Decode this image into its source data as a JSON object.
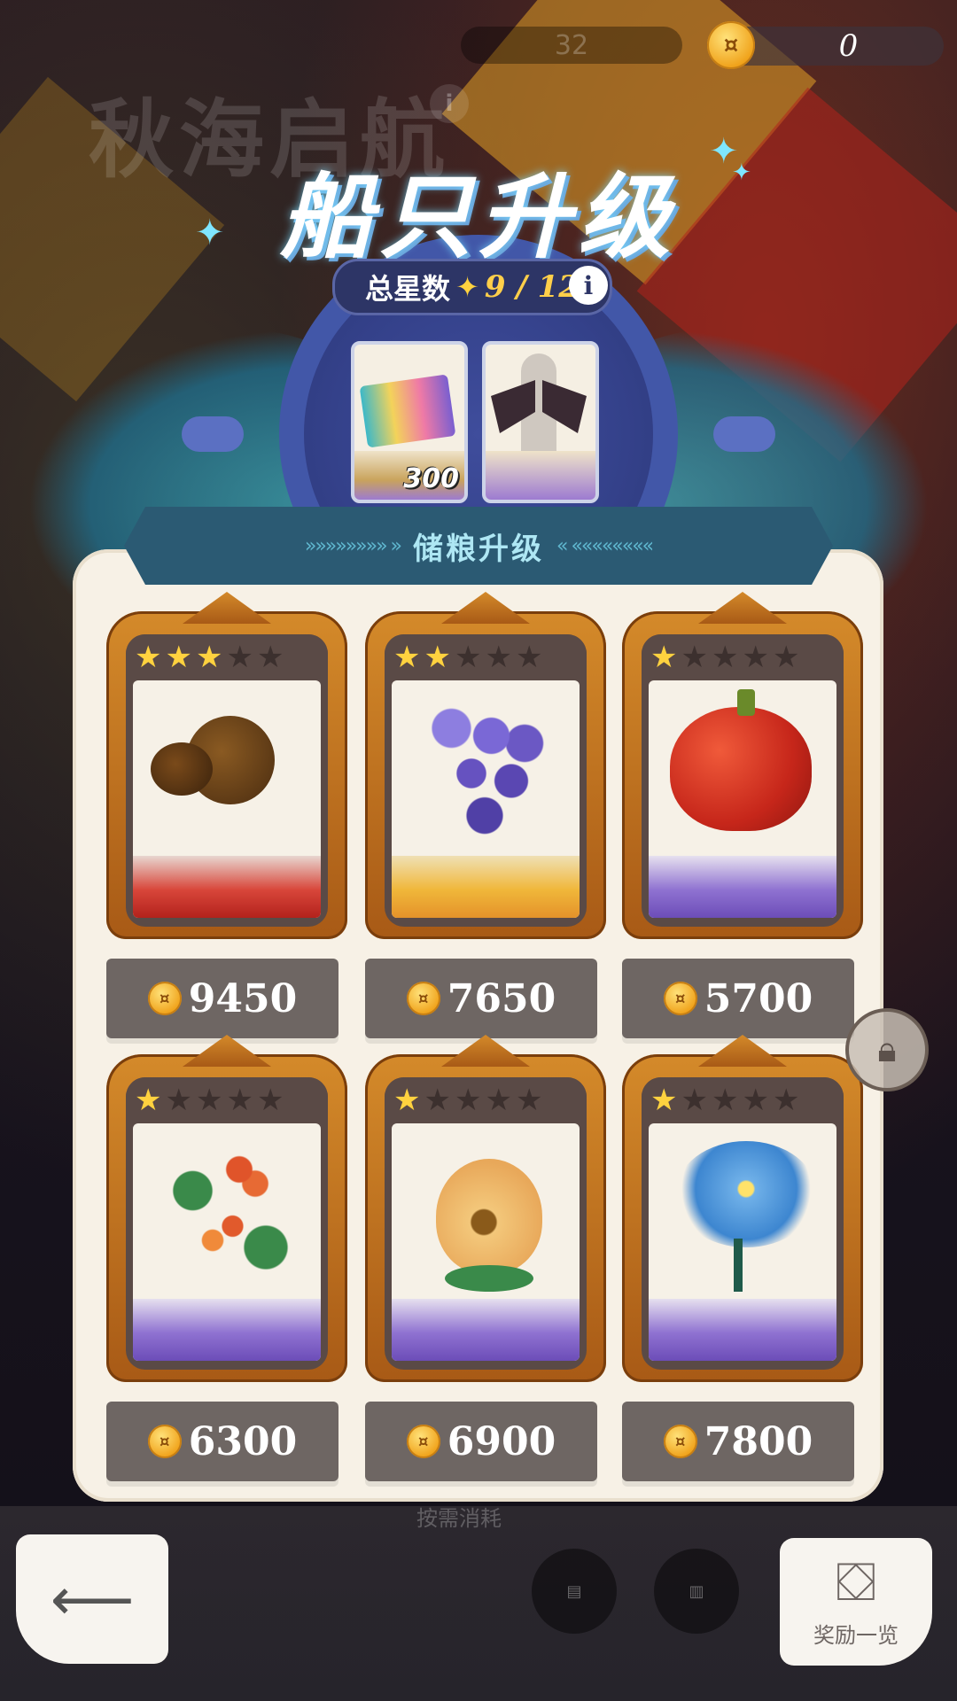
{
  "header": {
    "bg_title": "秋海启航",
    "bg_counter": "32",
    "currency_value": "0"
  },
  "upgrade": {
    "title": "船只升级",
    "stars_label": "总星数",
    "stars_count": "9 / 12",
    "info_symbol": "i"
  },
  "rewards": [
    {
      "name": "ticket",
      "amount": "300"
    },
    {
      "name": "bat-wings-costume",
      "amount": ""
    }
  ],
  "section": {
    "title": "储粮升级"
  },
  "items": [
    {
      "name": "chestnut",
      "stars": 3,
      "max_stars": 5,
      "price": "9450",
      "ground": "red"
    },
    {
      "name": "grape",
      "stars": 2,
      "max_stars": 5,
      "price": "7650",
      "ground": "gold"
    },
    {
      "name": "apple",
      "stars": 1,
      "max_stars": 5,
      "price": "5700",
      "ground": "purple"
    },
    {
      "name": "berry-branch",
      "stars": 1,
      "max_stars": 5,
      "price": "6300",
      "ground": "purple"
    },
    {
      "name": "onion",
      "stars": 1,
      "max_stars": 5,
      "price": "6900",
      "ground": "purple"
    },
    {
      "name": "blue-flower",
      "stars": 1,
      "max_stars": 5,
      "price": "7800",
      "ground": "purple"
    }
  ],
  "footer": {
    "back_icon": "back-arrow-icon",
    "rewards_label": "奖励一览",
    "dim_label": "按需消耗"
  },
  "colors": {
    "panel": "#f7f1e6",
    "frame": "#d48a2a",
    "star_on": "#ffd23f",
    "banner": "#2b5a73"
  }
}
